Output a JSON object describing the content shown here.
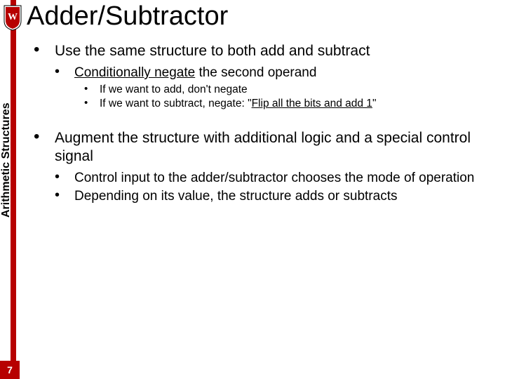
{
  "title": "Adder/Subtractor",
  "sidebar_label": "Arithmetic Structures",
  "page_number": "7",
  "bullets": {
    "p1": "Use the same structure to both add and subtract",
    "p1_1_a": "Conditionally negate",
    "p1_1_b": " the second operand",
    "p1_1_1": "If we want to add, don't negate",
    "p1_1_2_a": "If we want to subtract, negate: \"",
    "p1_1_2_b": "Flip all the bits and add 1",
    "p1_1_2_c": "\"",
    "p2": "Augment the structure with additional logic and a special control signal",
    "p2_1": "Control input to the adder/subtractor chooses the mode of operation",
    "p2_2": "Depending on its value, the structure adds or subtracts"
  }
}
